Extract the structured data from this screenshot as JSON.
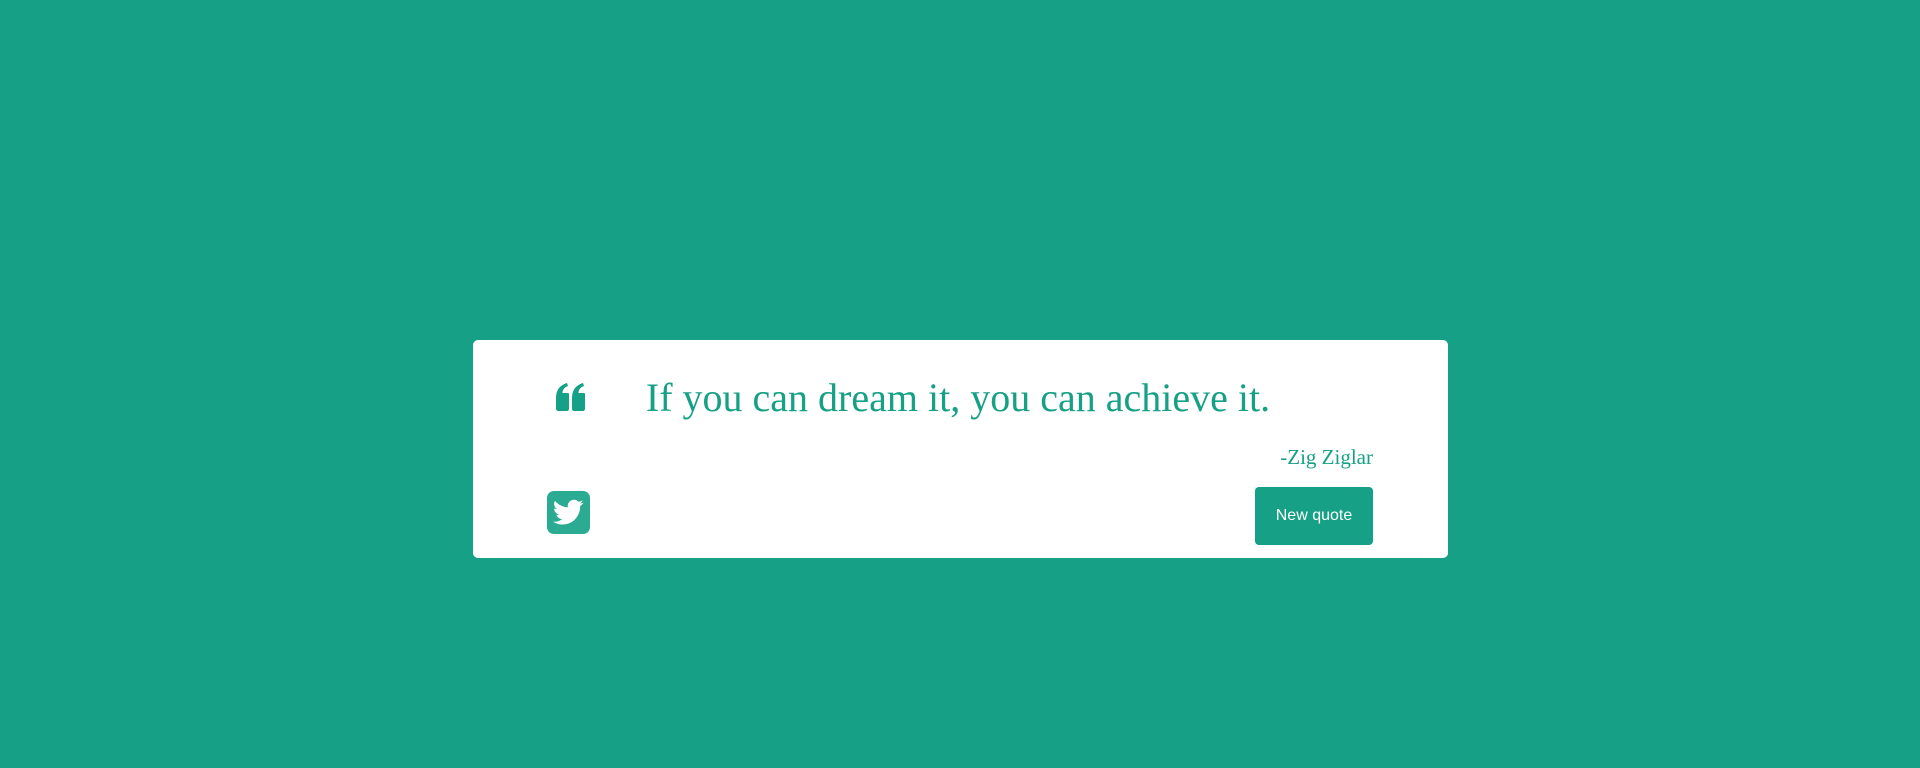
{
  "quote": {
    "text": "If you can dream it, you can achieve it.",
    "author": "-Zig Ziglar"
  },
  "buttons": {
    "tweet_icon": "twitter-icon",
    "new_quote_label": "New quote"
  },
  "icons": {
    "quote_mark": "quote-left-icon"
  },
  "colors": {
    "background": "#16a085",
    "card": "#ffffff",
    "accent": "#16a085",
    "tweet_button": "#2bab92"
  }
}
